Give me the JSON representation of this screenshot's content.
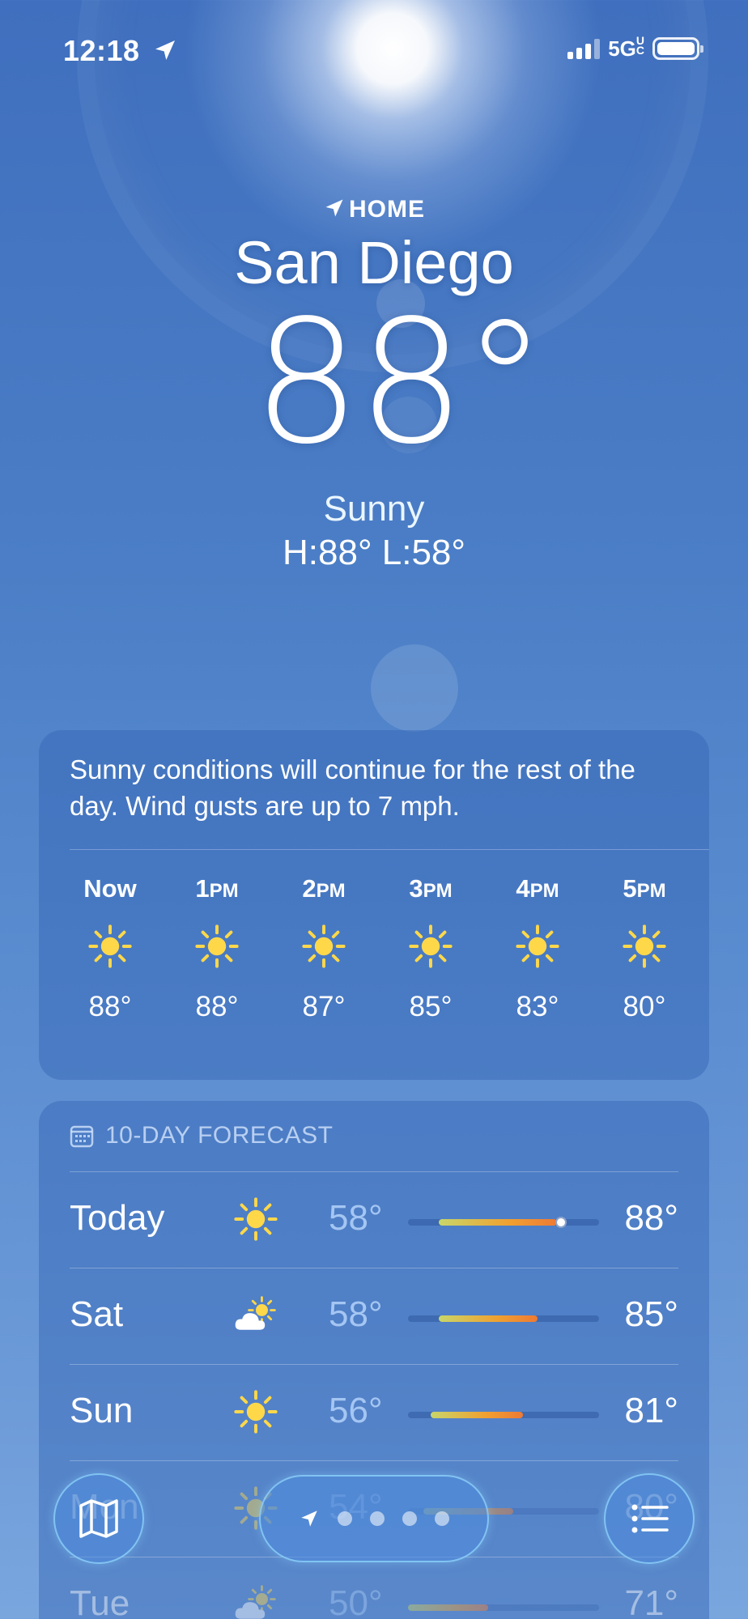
{
  "status_bar": {
    "time": "12:18",
    "network": "5GUC",
    "battery_percent": 100
  },
  "location": {
    "home_label": "HOME",
    "city": "San Diego",
    "temperature": "88°",
    "condition": "Sunny",
    "high_low": "H:88°  L:58°"
  },
  "hourly": {
    "summary": "Sunny conditions will continue for the rest of the day. Wind gusts are up to 7 mph.",
    "hours": [
      {
        "label": "Now",
        "suffix": "",
        "icon": "sun-icon",
        "temp": "88°"
      },
      {
        "label": "1",
        "suffix": "PM",
        "icon": "sun-icon",
        "temp": "88°"
      },
      {
        "label": "2",
        "suffix": "PM",
        "icon": "sun-icon",
        "temp": "87°"
      },
      {
        "label": "3",
        "suffix": "PM",
        "icon": "sun-icon",
        "temp": "85°"
      },
      {
        "label": "4",
        "suffix": "PM",
        "icon": "sun-icon",
        "temp": "83°"
      },
      {
        "label": "5",
        "suffix": "PM",
        "icon": "sun-icon",
        "temp": "80°"
      }
    ]
  },
  "forecast": {
    "title": "10-DAY FORECAST",
    "days": [
      {
        "day": "Today",
        "icon": "sun-icon",
        "low": "58°",
        "high": "88°",
        "bar_start": 0.16,
        "bar_end": 0.78,
        "current": 0.8
      },
      {
        "day": "Sat",
        "icon": "partly-cloudy-icon",
        "low": "58°",
        "high": "85°",
        "bar_start": 0.16,
        "bar_end": 0.68
      },
      {
        "day": "Sun",
        "icon": "sun-icon",
        "low": "56°",
        "high": "81°",
        "bar_start": 0.12,
        "bar_end": 0.6
      },
      {
        "day": "Mon",
        "icon": "sun-icon",
        "low": "54°",
        "high": "80°",
        "bar_start": 0.08,
        "bar_end": 0.55
      },
      {
        "day": "Tue",
        "icon": "partly-cloudy-icon",
        "low": "50°",
        "high": "71°",
        "bar_start": 0.0,
        "bar_end": 0.42
      }
    ]
  },
  "colors": {
    "sun_yellow": "#ffd84a",
    "bar_warm": "#f0a030",
    "bar_hot": "#ee7a35",
    "bar_cool": "#c8d66a"
  },
  "toolbar": {
    "page_count": 4,
    "map_icon": "map-icon",
    "list_icon": "list-icon"
  }
}
